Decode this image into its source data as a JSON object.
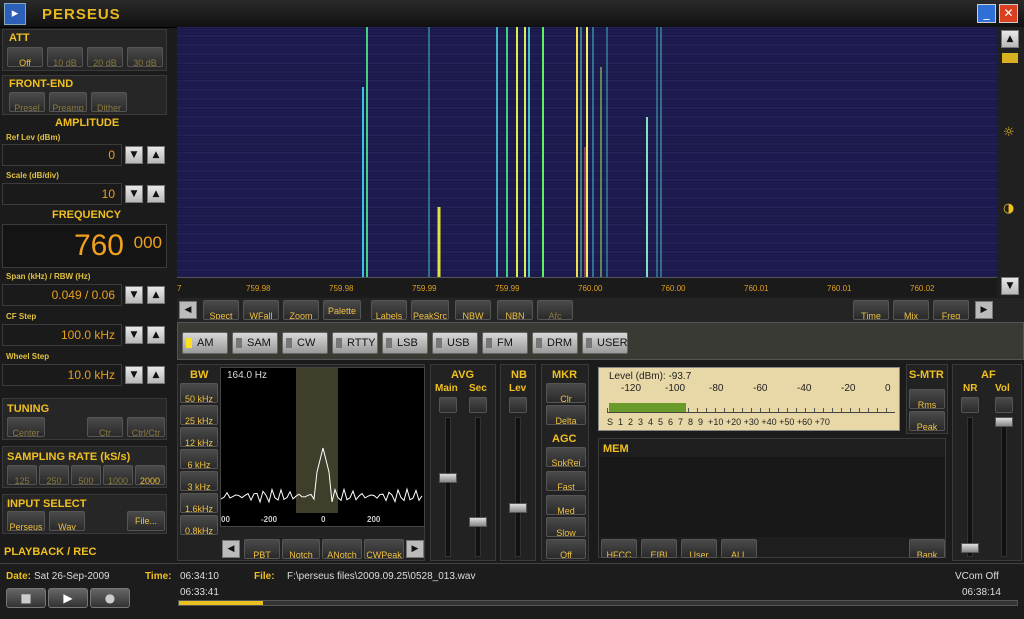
{
  "title": "PERSEUS",
  "att": {
    "label": "ATT",
    "buttons": [
      "Off",
      "10 dB",
      "20 dB",
      "30 dB"
    ]
  },
  "frontend": {
    "label": "FRONT-END",
    "buttons": [
      "Presel",
      "Preamp",
      "Dither"
    ]
  },
  "amplitude": {
    "label": "AMPLITUDE",
    "reflev_label": "Ref Lev (dBm)",
    "reflev_value": "0",
    "scale_label": "Scale (dB/div)",
    "scale_value": "10"
  },
  "frequency": {
    "label": "FREQUENCY",
    "main": "760",
    "sub": "000",
    "span_label": "Span (kHz) / RBW (Hz)",
    "span_value": "0.049 / 0.06",
    "cfstep_label": "CF Step",
    "cfstep_value": "100.0 kHz",
    "wheel_label": "Wheel Step",
    "wheel_value": "10.0 kHz"
  },
  "tuning": {
    "label": "TUNING",
    "buttons": [
      "Center",
      "Ctr",
      "Ctrl/Ctr"
    ]
  },
  "sampling": {
    "label": "SAMPLING RATE (kS/s)",
    "buttons": [
      "125",
      "250",
      "500",
      "1000",
      "2000"
    ]
  },
  "input": {
    "label": "INPUT SELECT",
    "buttons": [
      "Perseus",
      "Wav",
      "File..."
    ]
  },
  "playback_label": "PLAYBACK / REC",
  "scale_ticks": [
    "7",
    "759.98",
    "759.98",
    "759.99",
    "759.99",
    "760.00",
    "760.00",
    "760.01",
    "760.01",
    "760.02"
  ],
  "toolbar": {
    "left": [
      "Spect",
      "WFall",
      "Zoom",
      "Palette",
      "Labels",
      "PeakSrc",
      "NBW",
      "NBN",
      "Afc"
    ],
    "right": [
      "Time",
      "Mix",
      "Freq"
    ]
  },
  "modes": [
    "AM",
    "SAM",
    "CW",
    "RTTY",
    "LSB",
    "USB",
    "FM",
    "DRM",
    "USER"
  ],
  "bw": {
    "label": "BW",
    "buttons": [
      "50 kHz",
      "25 kHz",
      "12 kHz",
      "6 kHz",
      "3 kHz",
      "1.6kHz",
      "0.8kHz"
    ],
    "readout": "164.0 Hz"
  },
  "spectrum_ticks": [
    "00",
    "-200",
    "0",
    "200"
  ],
  "filter_buttons": [
    "PBT",
    "Notch",
    "ANotch",
    "CWPeak"
  ],
  "avg": {
    "label": "AVG",
    "main": "Main",
    "sec": "Sec"
  },
  "nb": {
    "label": "NB",
    "lev": "Lev"
  },
  "mkr": {
    "label": "MKR",
    "buttons": [
      "Clr",
      "Delta"
    ]
  },
  "agc": {
    "label": "AGC",
    "buttons": [
      "SpkRej",
      "Fast",
      "Med",
      "Slow",
      "Off"
    ]
  },
  "smeter": {
    "level": "Level (dBm): -93.7",
    "top_ticks": [
      "-120",
      "-100",
      "-80",
      "-60",
      "-40",
      "-20",
      "0"
    ],
    "bottom_ticks": "S  1  2  3  4  5  6  7  8  9  +10 +20 +30 +40 +50 +60 +70",
    "bar_fraction": 0.27
  },
  "smtr": {
    "label": "S-MTR",
    "buttons": [
      "Rms",
      "Peak"
    ]
  },
  "af": {
    "label": "AF",
    "nr": "NR",
    "vol": "Vol"
  },
  "mem": {
    "label": "MEM",
    "buttons": [
      "HFCC",
      "EIBI",
      "User",
      "ALL"
    ],
    "bank": "Bank"
  },
  "status": {
    "date_label": "Date:",
    "date_value": "Sat 26-Sep-2009",
    "time_label": "Time:",
    "time_value": "06:34:10",
    "file_label": "File:",
    "file_value": "F:\\perseus files\\2009.09.25\\0528_013.wav",
    "vcom": "VCom Off",
    "start_time": "06:33:41",
    "end_time": "06:38:14",
    "progress": 0.1
  }
}
